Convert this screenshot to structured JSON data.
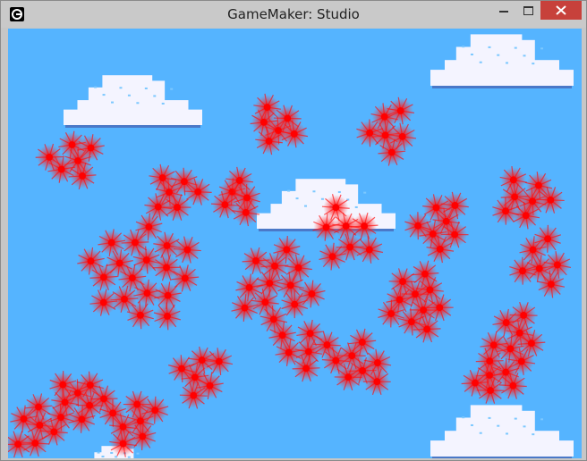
{
  "window": {
    "title": "GameMaker: Studio",
    "icon": "gamemaker-logo-icon",
    "controls": [
      "minimize-icon",
      "maximize-icon",
      "close-icon"
    ]
  },
  "scene": {
    "sky_color": "#55b4ff",
    "cloud_color": "#f4f4ff",
    "cloud_shadow": "#4a78c8",
    "particle_color": "#ff0000",
    "cloud_count": 5,
    "particle_cluster_count": 20
  }
}
